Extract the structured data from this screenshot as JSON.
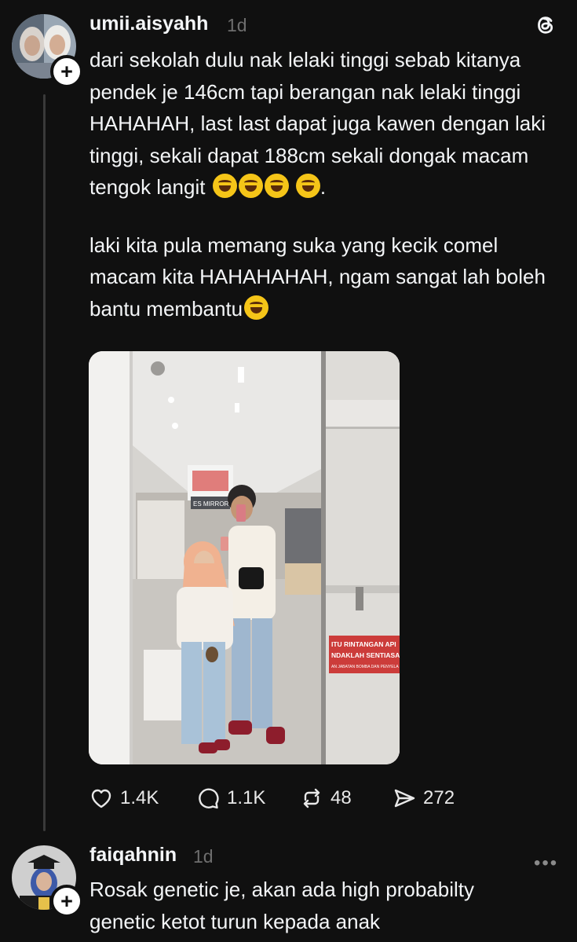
{
  "post": {
    "username": "umii.aisyahh",
    "time": "1d",
    "paragraph1": "dari sekolah dulu nak lelaki tinggi sebab kitanya pendek je 146cm tapi berangan nak lelaki tinggi HAHAHAH, last last dapat juga kawen dengan laki tinggi, sekali dapat 188cm sekali dongak macam tengok langit",
    "paragraph1_end": ".",
    "paragraph2": "laki kita pula memang suka yang kecik comel macam kita HAHAHAHAH, ngam sangat lah boleh bantu membantu",
    "photo_sign_line1": "ITU RINTANGAN API",
    "photo_sign_line2": "NDAKLAH SENTIASA",
    "photo_sign_line3": "AN JABATAN BOMBA DAN PENYELA",
    "photo_store_sign": "ES MIRROR",
    "likes": "1.4K",
    "replies": "1.1K",
    "reposts": "48",
    "shares": "272"
  },
  "reply": {
    "username": "faiqahnin",
    "time": "1d",
    "text_line1": "Rosak genetic je, akan ada high probabilty",
    "text_line2": "genetic ketot turun kepada anak"
  },
  "icons": {
    "app_logo": "threads-logo-icon",
    "like": "heart-icon",
    "reply": "comment-icon",
    "repost": "repost-icon",
    "share": "send-icon",
    "more": "more-icon"
  }
}
